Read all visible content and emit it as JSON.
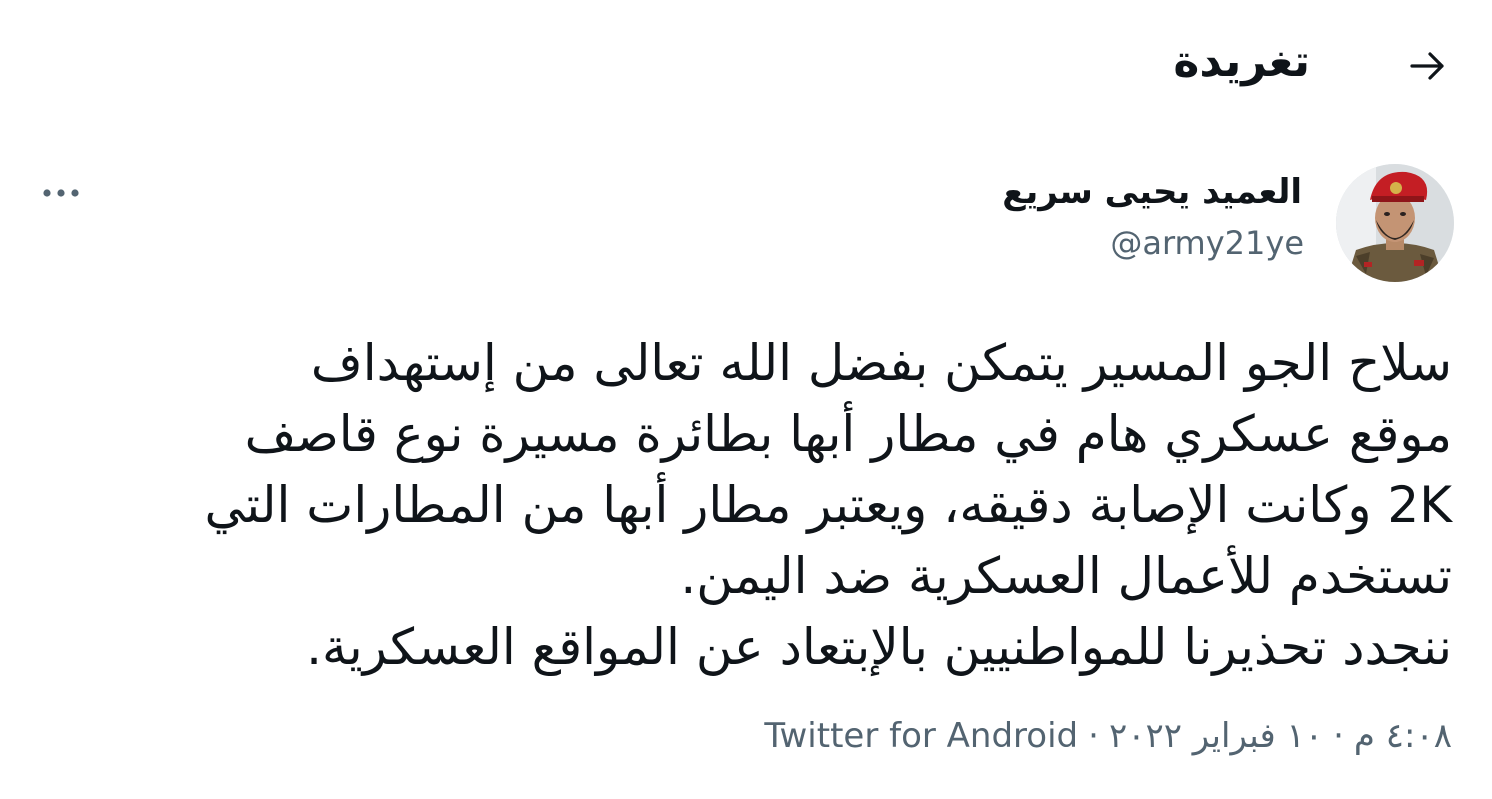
{
  "header": {
    "title": "تغريدة",
    "back_icon": "arrow-right-icon"
  },
  "author": {
    "display_name": "العميد يحيى سريع",
    "handle": "@army21ye",
    "avatar_icon": "profile-photo"
  },
  "more_icon": "more-horizontal-icon",
  "tweet": {
    "lines": [
      "سلاح الجو المسير يتمكن بفضل الله تعالى من إستهداف",
      "موقع عسكري هام في مطار أبها بطائرة مسيرة نوع قاصف",
      "2K وكانت الإصابة دقيقه، ويعتبر مطار أبها من المطارات التي",
      "تستخدم للأعمال العسكرية ضد اليمن.",
      "ننجدد تحذيرنا للمواطنيين بالإبتعاد عن المواقع العسكرية."
    ]
  },
  "meta": {
    "time": "٤:٠٨ م",
    "date": "١٠ فبراير ٢٠٢٢",
    "separator": "·",
    "source": "Twitter for Android"
  },
  "colors": {
    "text": "#0f1419",
    "secondary": "#536471",
    "background": "#ffffff"
  }
}
